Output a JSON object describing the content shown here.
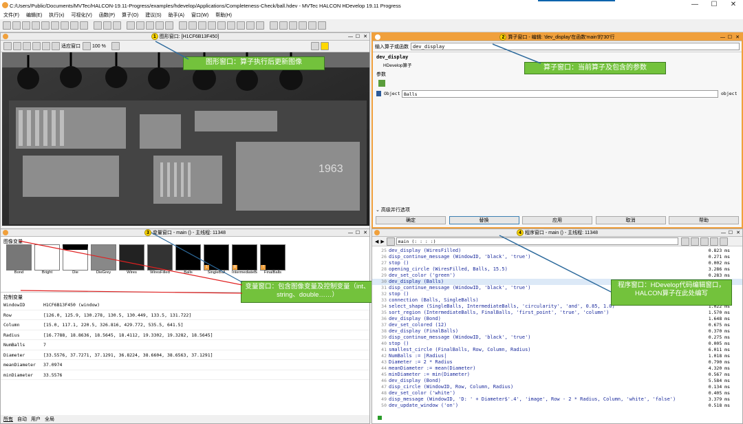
{
  "window": {
    "title": "C:/Users/Public/Documents/MVTec/HALCON-19.11-Progress/examples/hdevelop/Applications/Completeness-Check/ball.hdev - MVTec HALCON HDevelop 19.11 Progress",
    "min": "—",
    "max": "☐",
    "close": "✕"
  },
  "menu": [
    "文件(F)",
    "编辑(E)",
    "执行(x)",
    "可视化(V)",
    "函数(P)",
    "算子(O)",
    "建议(S)",
    "助手(A)",
    "窗口(W)",
    "帮助(H)"
  ],
  "graphics": {
    "badge": "1",
    "title": "图形窗口: [H1CF6B13F450]",
    "zoom_fit": "适应窗口",
    "zoom_pct": "100 %",
    "callout": "图形窗口：算子执行后更新图像"
  },
  "operator": {
    "badge": "2",
    "title": "算子窗口 - 编辑: 'dev_display'在函数'main'的'30'行",
    "input_label": "输入算子或函数",
    "input_value": "dev_display",
    "name": "dev_display",
    "subtitle": "HDevelop算子",
    "params_label": "参数",
    "param_type": "Object",
    "param_value": "Balls",
    "param_kind": "object",
    "advanced": "高级并行选项",
    "callout": "算子窗口：当前算子及包含的参数",
    "buttons": [
      "确定",
      "替换",
      "应用",
      "取消",
      "帮助"
    ]
  },
  "variables": {
    "badge": "3",
    "title": "变量窗口 - main () - 主线程: 11348",
    "image_vars_label": "图像变量",
    "control_vars_label": "控制变量",
    "thumbs": [
      "Bond",
      "Bright",
      "Die",
      "DieGrey",
      "Wires",
      "WiresFilled",
      "Balls",
      "SingleBall",
      "IntermediateBalls",
      "FinalBalls"
    ],
    "thumb_badges": [
      "",
      "",
      "",
      "",
      "",
      "",
      "",
      "1",
      "8",
      "7"
    ],
    "controls": [
      {
        "k": "WindowID",
        "v": "H1CF6B13F450 (window)"
      },
      {
        "k": "Row",
        "v": "[126.0, 125.9, 130.278, 130.5, 130.449, 133.5, 131.722]"
      },
      {
        "k": "Column",
        "v": "[15.0, 117.1, 220.5, 326.816, 429.772, 535.5, 641.5]"
      },
      {
        "k": "Radius",
        "v": "[16.7788, 18.8636, 18.5645, 18.4112, 19.3302, 19.3282, 18.5645]"
      },
      {
        "k": "NumBalls",
        "v": "7"
      },
      {
        "k": "Diameter",
        "v": "[33.5576, 37.7271, 37.1291, 36.8224, 38.6604, 38.6563, 37.1291]"
      },
      {
        "k": "meanDiameter",
        "v": "37.0974"
      },
      {
        "k": "minDiameter",
        "v": "33.5576"
      }
    ],
    "tabs": [
      "所有",
      "自动",
      "用户",
      "全局"
    ],
    "callout": "变量窗口：包含图像变量及控制变量（int、string、double……）"
  },
  "program": {
    "badge": "4",
    "title": "程序窗口 - main () - 主线程: 11348",
    "proc": "main (: : : :)",
    "callout": "程序窗口：HDevelop代码编辑窗口，HALCON算子在此处编写",
    "lines": [
      {
        "n": "25",
        "c": "dev_display (WiresFilled)",
        "t": "0.823 ms"
      },
      {
        "n": "26",
        "c": "disp_continue_message (WindowID, 'black', 'true')",
        "t": "0.271 ms"
      },
      {
        "n": "27",
        "c": "stop ()",
        "t": "0.002 ms"
      },
      {
        "n": "28",
        "c": "opening_circle (WiresFilled, Balls, 15.5)",
        "t": "3.286 ms"
      },
      {
        "n": "29",
        "c": "dev_set_color ('green')",
        "t": "0.283 ms"
      },
      {
        "n": "30",
        "c": "dev_display (Balls)",
        "t": "0.280 ms"
      },
      {
        "n": "31",
        "c": "disp_continue_message (WindowID, 'black', 'true')",
        "t": "0.237 ms"
      },
      {
        "n": "32",
        "c": "stop ()",
        "t": "0.002 ms"
      },
      {
        "n": "33",
        "c": "connection (Balls, SingleBalls)",
        "t": "0.186 ms"
      },
      {
        "n": "34",
        "c": "select_shape (SingleBalls, IntermediateBalls, 'circularity', 'and', 0.85, 1.0)",
        "t": "1.022 ms"
      },
      {
        "n": "35",
        "c": "sort_region (IntermediateBalls, FinalBalls, 'first_point', 'true', 'column')",
        "t": "1.570 ms"
      },
      {
        "n": "36",
        "c": "dev_display (Bond)",
        "t": "1.648 ms"
      },
      {
        "n": "37",
        "c": "dev_set_colored (12)",
        "t": "0.675 ms"
      },
      {
        "n": "38",
        "c": "dev_display (FinalBalls)",
        "t": "0.370 ms"
      },
      {
        "n": "39",
        "c": "disp_continue_message (WindowID, 'black', 'true')",
        "t": "0.275 ms"
      },
      {
        "n": "40",
        "c": "stop ()",
        "t": "0.005 ms"
      },
      {
        "n": "41",
        "c": "smallest_circle (FinalBalls, Row, Column, Radius)",
        "t": "6.011 ms"
      },
      {
        "n": "42",
        "c": "NumBalls := |Radius|",
        "t": "1.018 ms"
      },
      {
        "n": "43",
        "c": "Diameter := 2 * Radius",
        "t": "0.790 ms"
      },
      {
        "n": "44",
        "c": "meanDiameter := mean(Diameter)",
        "t": "4.320 ms"
      },
      {
        "n": "45",
        "c": "minDiameter := min(Diameter)",
        "t": "0.567 ms"
      },
      {
        "n": "46",
        "c": "dev_display (Bond)",
        "t": "5.584 ms"
      },
      {
        "n": "47",
        "c": "disp_circle (WindowID, Row, Column, Radius)",
        "t": "0.134 ms"
      },
      {
        "n": "48",
        "c": "dev_set_color ('white')",
        "t": "0.405 ms"
      },
      {
        "n": "49",
        "c": "disp_message (WindowID, 'D: ' + Diameter$'.4', 'image', Row - 2 * Radius, Column, 'white', 'false')",
        "t": "3.379 ms"
      },
      {
        "n": "50",
        "c": "dev_update_window ('on')",
        "t": "0.518 ms"
      }
    ]
  },
  "colors": {
    "accent_orange": "#f0a03c",
    "callout_green": "#73c23c",
    "badge_yellow": "#ffd800"
  }
}
